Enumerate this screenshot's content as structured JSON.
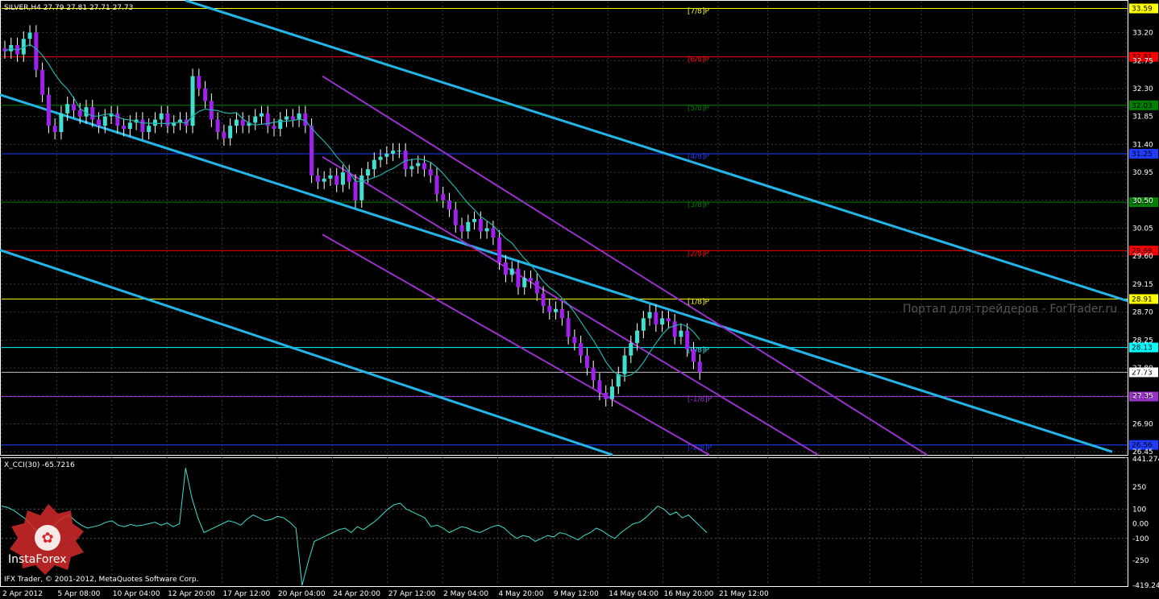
{
  "header": {
    "title": "SILVER,H4  27.79 27.81 27.71 27.73",
    "indicator": "X_CCI(30) -65.7216",
    "copyright": "IFX Trader, © 2001-2012, MetaQuotes Software Corp.",
    "watermark": "Портал для трейдеров - ForTrader.ru",
    "logo_text": "InstaForex"
  },
  "chart_data": {
    "type": "candlestick",
    "symbol": "SILVER",
    "timeframe": "H4",
    "last": 27.73,
    "ylim": [
      26.4,
      33.7
    ],
    "price_ticks": [
      "33.20",
      "32.75",
      "32.30",
      "31.85",
      "31.40",
      "30.95",
      "30.50",
      "30.05",
      "29.60",
      "29.15",
      "28.70",
      "28.25",
      "27.80",
      "27.35",
      "26.90",
      "26.45"
    ],
    "x_labels": [
      "2 Apr 2012",
      "5 Apr 08:00",
      "10 Apr 04:00",
      "12 Apr 20:00",
      "17 Apr 12:00",
      "20 Apr 04:00",
      "24 Apr 20:00",
      "27 Apr 12:00",
      "2 May 04:00",
      "4 May 20:00",
      "9 May 12:00",
      "14 May 04:00",
      "16 May 20:00",
      "21 May 12:00"
    ],
    "murrey_levels": [
      {
        "label": "[7/8]P",
        "value": 33.59,
        "value_text": "33.59",
        "color": "#ffff00"
      },
      {
        "label": "[6/8]P",
        "value": 32.81,
        "value_text": "32.81",
        "color": "#ff0000"
      },
      {
        "label": "[5/8]P",
        "value": 32.03,
        "value_text": "32.03",
        "color": "#008000"
      },
      {
        "label": "[4/8]P",
        "value": 31.25,
        "value_text": "31.25",
        "color": "#1e3cff"
      },
      {
        "label": "[3/8]P",
        "value": 30.47,
        "value_text": "30.47",
        "color": "#008000"
      },
      {
        "label": "[2/8]P",
        "value": 29.69,
        "value_text": "29.69",
        "color": "#ff0000"
      },
      {
        "label": "[1/8]P",
        "value": 28.91,
        "value_text": "28.91",
        "color": "#ffff00"
      },
      {
        "label": "[0/8]P",
        "value": 28.13,
        "value_text": "28.13",
        "color": "#00ffff"
      },
      {
        "label": "[-1/8]P",
        "value": 27.34,
        "value_text": "27.34",
        "color": "#9932cc"
      },
      {
        "label": "[-2/8]P",
        "value": 26.56,
        "value_text": "26.56",
        "color": "#1e3cff"
      }
    ],
    "current_price_text": "27.73",
    "cci": {
      "name": "X_CCI(30)",
      "value": -65.7216,
      "ylim": [
        -419.246,
        441.274
      ],
      "ticks": [
        "441.274",
        "250",
        "100",
        "0.00",
        "-100",
        "-250",
        "-419.246"
      ],
      "tick_values": [
        441.274,
        250,
        100,
        0,
        -100,
        -250,
        -419.246
      ],
      "series": [
        120,
        110,
        90,
        60,
        30,
        -20,
        -60,
        -90,
        -40,
        10,
        40,
        60,
        20,
        -10,
        -30,
        -20,
        -10,
        10,
        20,
        -10,
        -20,
        -5,
        -15,
        -10,
        0,
        10,
        -10,
        5,
        -20,
        0,
        380,
        180,
        40,
        -60,
        -40,
        -20,
        0,
        20,
        10,
        -10,
        30,
        60,
        40,
        20,
        30,
        50,
        40,
        10,
        -30,
        -420,
        -260,
        -120,
        -100,
        -80,
        -60,
        -40,
        -30,
        -60,
        -20,
        -40,
        -10,
        20,
        60,
        100,
        130,
        140,
        100,
        80,
        60,
        40,
        -20,
        -10,
        -30,
        -60,
        -40,
        -20,
        -30,
        -50,
        -60,
        -40,
        -20,
        -10,
        -30,
        -70,
        -100,
        -80,
        -90,
        -120,
        -100,
        -80,
        -90,
        -60,
        -70,
        -90,
        -110,
        -80,
        -60,
        -30,
        -50,
        -80,
        -100,
        -60,
        -30,
        0,
        10,
        40,
        80,
        120,
        100,
        60,
        80,
        40,
        60,
        20,
        -20,
        -60
      ],
      "color": "#40e0d0"
    },
    "close_series": [
      32.9,
      33.0,
      32.85,
      33.1,
      33.2,
      32.6,
      32.2,
      31.7,
      31.6,
      31.9,
      32.05,
      31.95,
      31.85,
      32.0,
      31.8,
      31.7,
      31.85,
      31.9,
      31.7,
      31.65,
      31.75,
      31.8,
      31.6,
      31.7,
      31.8,
      31.9,
      31.7,
      31.75,
      31.8,
      31.7,
      32.5,
      32.3,
      32.1,
      31.8,
      31.6,
      31.5,
      31.7,
      31.8,
      31.7,
      31.75,
      31.85,
      31.9,
      31.7,
      31.65,
      31.8,
      31.85,
      31.8,
      31.9,
      31.7,
      30.9,
      30.8,
      30.85,
      30.9,
      30.75,
      30.95,
      30.8,
      30.5,
      30.9,
      31.0,
      31.15,
      31.2,
      31.25,
      31.3,
      31.3,
      31.0,
      31.05,
      31.1,
      31.0,
      30.9,
      30.6,
      30.5,
      30.35,
      30.1,
      30.0,
      30.15,
      30.2,
      30.0,
      30.05,
      29.9,
      29.5,
      29.3,
      29.4,
      29.1,
      29.25,
      29.2,
      29.0,
      28.8,
      28.7,
      28.75,
      28.6,
      28.3,
      28.2,
      28.0,
      27.8,
      27.6,
      27.4,
      27.3,
      27.5,
      27.7,
      28.0,
      28.2,
      28.4,
      28.6,
      28.7,
      28.5,
      28.6,
      28.55,
      28.3,
      28.4,
      28.1,
      27.9,
      27.73
    ]
  }
}
